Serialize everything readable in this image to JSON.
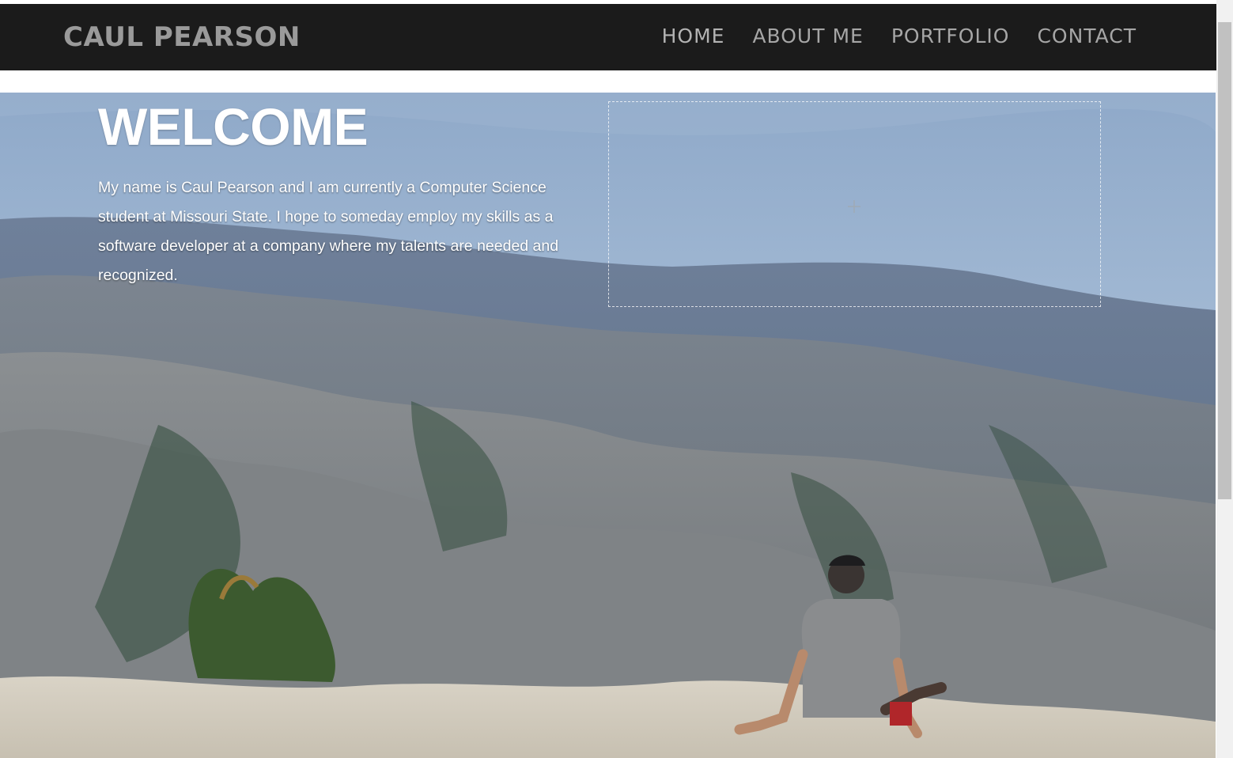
{
  "navbar": {
    "brand": "CAUL PEARSON",
    "links": [
      {
        "label": "HOME"
      },
      {
        "label": "ABOUT ME"
      },
      {
        "label": "PORTFOLIO"
      },
      {
        "label": "CONTACT"
      }
    ]
  },
  "hero": {
    "title": "WELCOME",
    "text": "My name is Caul Pearson and I am currently a Computer Science student at Missouri State. I hope to someday employ my skills as a software developer at a company where my talents are needed and recognized.",
    "background": "mountain-valley-photo",
    "placeholder_icon": "plus-icon"
  },
  "colors": {
    "navbar_bg": "#1b1b1b",
    "nav_text": "#a6a6a6",
    "brand_text": "#9a9a9a",
    "hero_text": "#ffffff"
  }
}
